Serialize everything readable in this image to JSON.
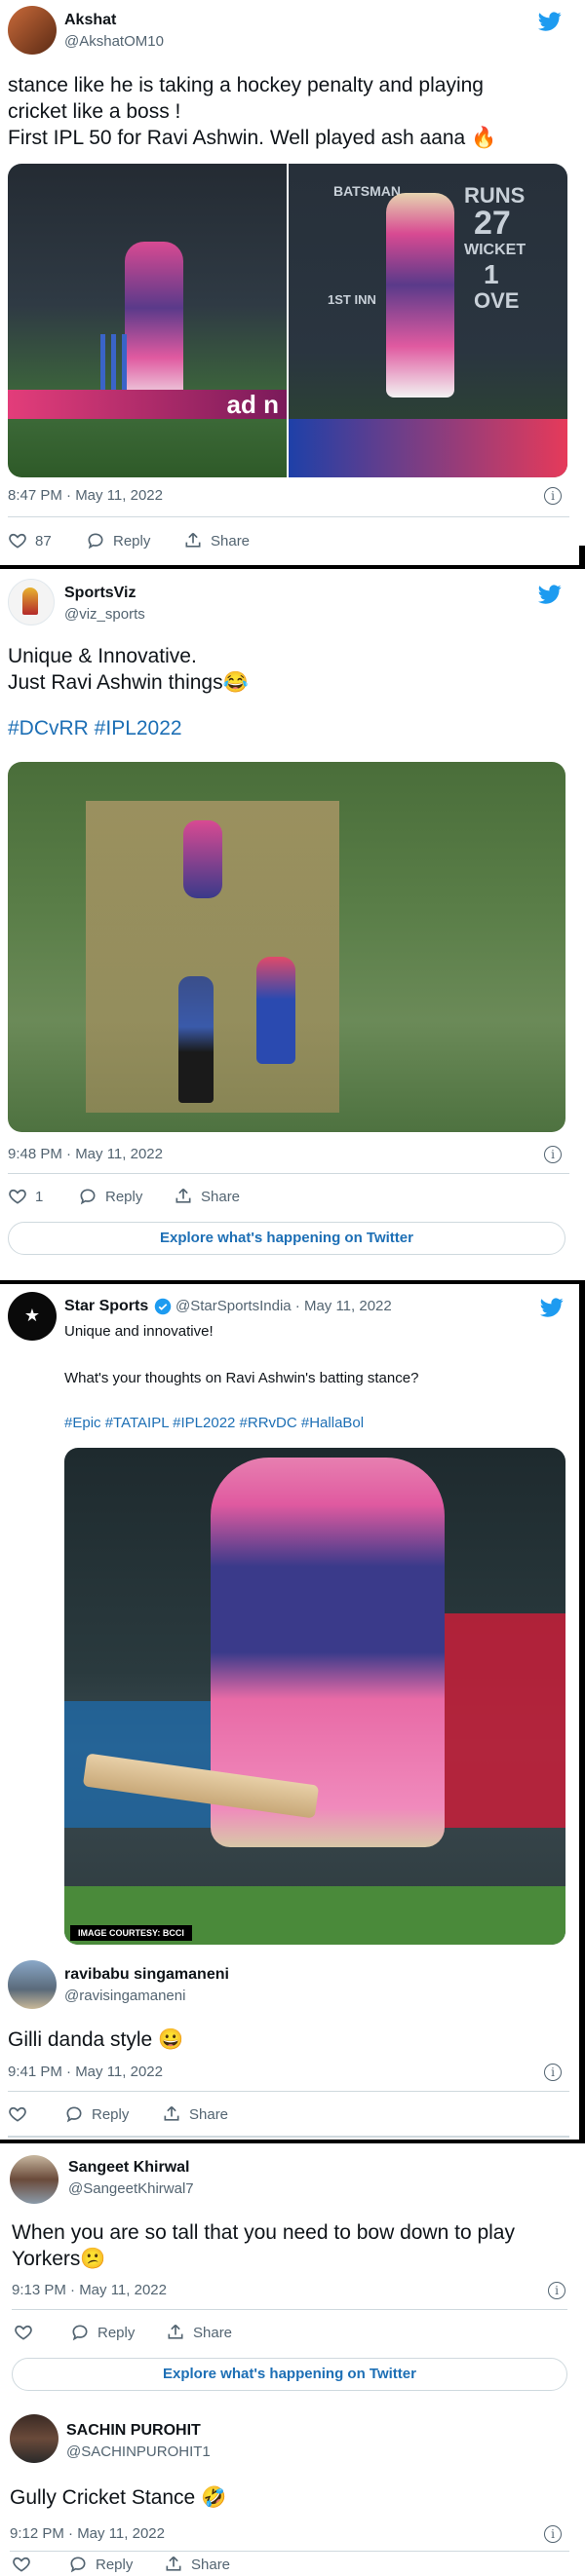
{
  "tweet1": {
    "name": "Akshat",
    "handle": "@AkshatOM10",
    "text_line1": "stance like he is taking a hockey penalty and playing",
    "text_line2": "cricket like a boss !",
    "text_line3": "First IPL 50 for Ravi Ashwin. Well played ash aana 🔥",
    "scoreboard": {
      "col1": "BATSMAN",
      "col2": "RUNS",
      "runs": "27",
      "wicket_label": "WICKET",
      "wicket": "1",
      "inn": "1ST INN",
      "over": "OVE"
    },
    "timestamp": "8:47 PM · May 11, 2022",
    "likes": "87",
    "reply_label": "Reply",
    "share_label": "Share"
  },
  "tweet2": {
    "name": "SportsViz",
    "handle": "@viz_sports",
    "text_line1": "Unique & Innovative.",
    "text_line2": "Just Ravi Ashwin things😂",
    "hashtags": "#DCvRR #IPL2022",
    "timestamp": "9:48 PM · May 11, 2022",
    "likes": "1",
    "reply_label": "Reply",
    "share_label": "Share",
    "explore_label": "Explore what's happening on Twitter"
  },
  "tweet3": {
    "name": "Star Sports",
    "handle": "@StarSportsIndia · May 11, 2022",
    "text_line1": "Unique and innovative!",
    "text_line2": "What's your thoughts on Ravi Ashwin's batting stance?",
    "hashtags": "#Epic #TATAIPL #IPL2022 #RRvDC #HallaBol",
    "image_credit": "IMAGE COURTESY: BCCI"
  },
  "tweet4": {
    "name": "ravibabu singamaneni",
    "handle": "@ravisingamaneni",
    "text": "Gilli danda style 😀",
    "timestamp": "9:41 PM · May 11, 2022",
    "reply_label": "Reply",
    "share_label": "Share"
  },
  "tweet5": {
    "name": "Sangeet Khirwal",
    "handle": "@SangeetKhirwal7",
    "text_line1": "When you are so tall that you need to bow down to play",
    "text_line2": "Yorkers😕",
    "timestamp": "9:13 PM · May 11, 2022",
    "reply_label": "Reply",
    "share_label": "Share",
    "explore_label": "Explore what's happening on Twitter"
  },
  "tweet6": {
    "name": "SACHIN PUROHIT",
    "handle": "@SACHINPUROHIT1",
    "text": "Gully Cricket Stance 🤣",
    "timestamp": "9:12 PM · May 11, 2022",
    "reply_label": "Reply",
    "share_label": "Share"
  },
  "colors": {
    "twitter_blue": "#1d9bf0",
    "link_blue": "#1d6fb5",
    "text": "#0f1419",
    "muted": "#536471"
  }
}
